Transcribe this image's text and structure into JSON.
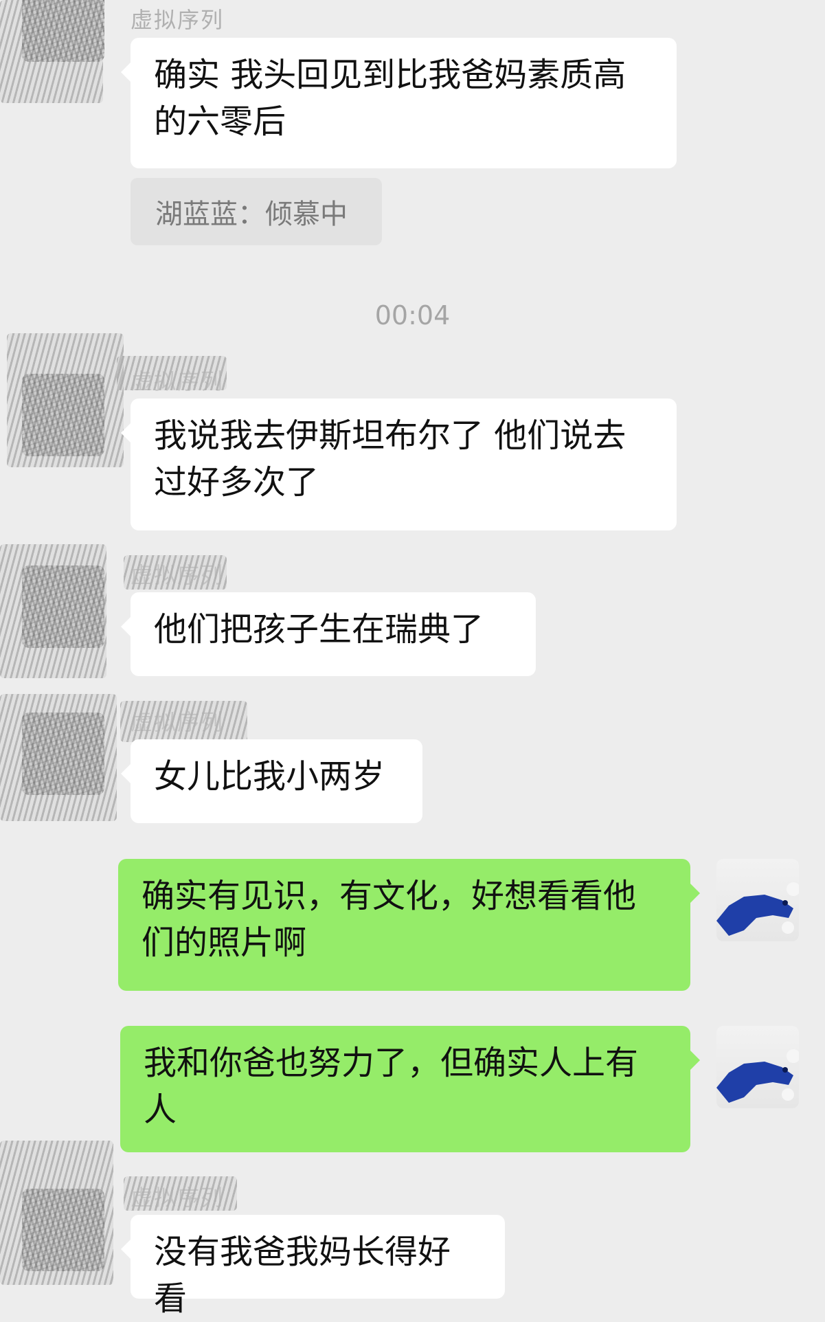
{
  "messages": [
    {
      "sender_name": "虚拟序列",
      "text": "确实 我头回见到比我爸妈素质高的六零后"
    },
    {
      "quote": "湖蓝蓝：倾慕中"
    },
    {
      "timestamp": "00:04"
    },
    {
      "sender_name": "虚拟序列",
      "text": "我说我去伊斯坦布尔了 他们说去过好多次了"
    },
    {
      "sender_name": "虚拟序列",
      "text": "他们把孩子生在瑞典了"
    },
    {
      "sender_name": "虚拟序列",
      "text": "女儿比我小两岁"
    },
    {
      "text": "确实有见识，有文化，好想看看他们的照片啊"
    },
    {
      "text": "我和你爸也努力了，但确实人上有人"
    },
    {
      "sender_name": "虚拟序列",
      "text": "没有我爸我妈长得好看"
    }
  ],
  "colors": {
    "background": "#ededed",
    "incoming": "#ffffff",
    "outgoing": "#95ec69"
  },
  "icons": {
    "incoming_avatar": "scribbled-avatar",
    "outgoing_avatar": "blue-horse-avatar"
  }
}
